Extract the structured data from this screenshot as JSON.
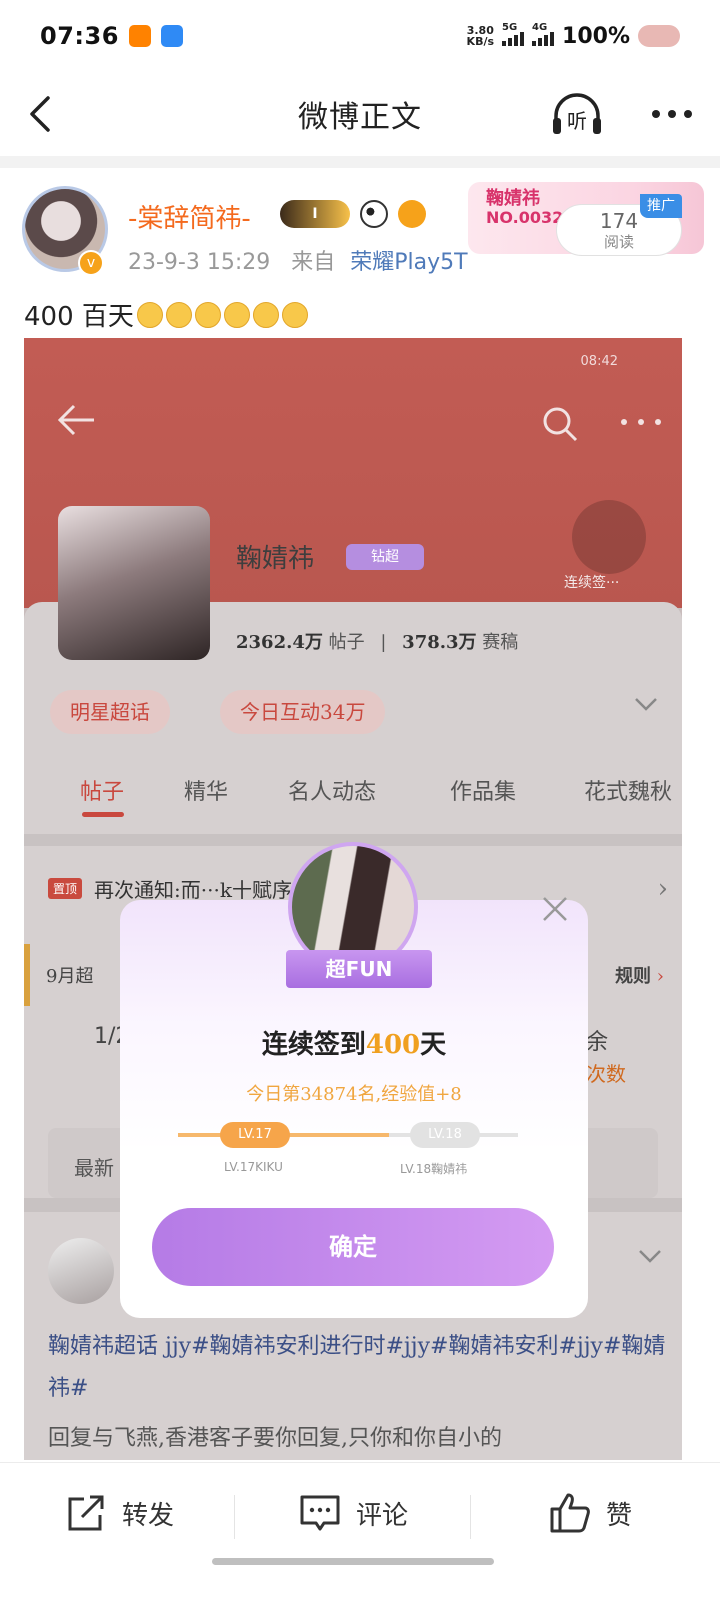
{
  "status_bar": {
    "time": "07:36",
    "net_speed_value": "3.80",
    "net_speed_unit": "KB/s",
    "sim1": "5G",
    "sim2": "4G",
    "battery": "100%"
  },
  "nav": {
    "title": "微博正文",
    "listen_label": "听"
  },
  "post": {
    "username": "-棠辞简祎-",
    "member_level": "I",
    "time": "23-9-3 15:29",
    "source_prefix": "来自",
    "source": "荣耀Play5T",
    "fan_card_name": "鞠婧祎",
    "fan_card_no": "NO.0032",
    "read_count": "174",
    "read_label": "阅读",
    "promo_label": "推广",
    "text": "400 百天"
  },
  "embedded_screenshot": {
    "status_time": "08:42",
    "profile_name": "鞠婧祎",
    "tier_badge": "钻超",
    "stats_posts_value": "2362.4万",
    "stats_posts_label": "帖子",
    "stats_fans_value": "378.3万",
    "stats_fans_label": "赛稿",
    "checkin_label": "连续签···",
    "pill_1": "明星超话",
    "pill_2": "今日互动34万",
    "tabs": [
      "帖子",
      "精华",
      "名人动态",
      "作品集",
      "花式魏秋"
    ],
    "notice_tag": "置顶",
    "notice_text": "再次通知:而···k十赋序章I盲···",
    "rules_left": "9月超",
    "rules_right": "规则",
    "count_left": "1/2",
    "count_right": "余",
    "count_sub": "次数",
    "latest_label": "最新",
    "post_text": "鞠婧祎超话 jjy#鞠婧祎安利进行时#jjy#鞠婧祎安利#jjy#鞠婧祎#",
    "post_text_2": "回复与飞燕,香港客子要你回复,只你和你自小的"
  },
  "modal": {
    "ribbon": "超FUN",
    "title_prefix": "连续签到",
    "title_days": "400",
    "title_suffix": "天",
    "subtitle": "今日第34874名,经验值+8",
    "lv_current": "LV.17",
    "lv_next": "LV.18",
    "lv_current_name": "LV.17KIKU",
    "lv_next_name": "LV.18鞠婧祎",
    "progress": 0.62,
    "confirm_label": "确定"
  },
  "bottom_bar": {
    "repost": "转发",
    "comment": "评论",
    "like": "赞"
  },
  "colors": {
    "username": "#f46a1e",
    "source": "#4f7ab9",
    "accent_purple": "#b57be6",
    "shot_red": "#c25c54"
  }
}
